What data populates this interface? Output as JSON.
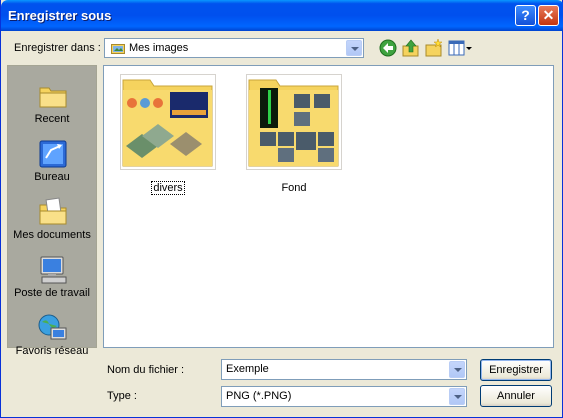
{
  "window": {
    "title": "Enregistrer sous",
    "help_label": "?",
    "close_label": "✕"
  },
  "location": {
    "label": "Enregistrer dans :",
    "value": "Mes images",
    "icon": "my-pictures-icon"
  },
  "nav_icons": [
    "back-icon",
    "up-folder-icon",
    "new-folder-icon",
    "view-menu-icon"
  ],
  "places": [
    {
      "label": "Recent",
      "icon": "recent-folder-icon"
    },
    {
      "label": "Bureau",
      "icon": "desktop-icon"
    },
    {
      "label": "Mes documents",
      "icon": "my-documents-icon"
    },
    {
      "label": "Poste de travail",
      "icon": "my-computer-icon"
    },
    {
      "label": "Favoris réseau",
      "icon": "network-places-icon"
    }
  ],
  "folders": [
    {
      "name": "divers",
      "selected": true
    },
    {
      "name": "Fond",
      "selected": false
    }
  ],
  "filename": {
    "label": "Nom du fichier :",
    "value": "Exemple"
  },
  "filetype": {
    "label": "Type :",
    "value": "PNG (*.PNG)"
  },
  "buttons": {
    "save": "Enregistrer",
    "cancel": "Annuler"
  },
  "colors": {
    "titlebar": "#0054e3",
    "dialog_bg": "#ece9d8",
    "places_bg": "#a9a99f",
    "folder": "#f5d35e"
  }
}
